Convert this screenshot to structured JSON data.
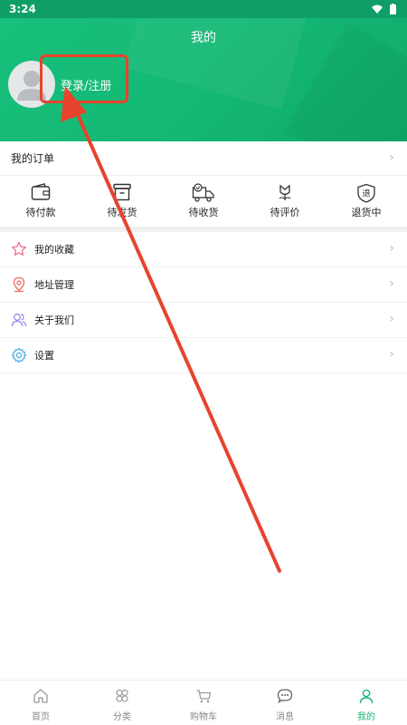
{
  "status_bar": {
    "time": "3:24"
  },
  "header": {
    "title": "我的",
    "login_label": "登录/注册"
  },
  "orders": {
    "section_title": "我的订单",
    "items": [
      {
        "label": "待付款",
        "icon": "wallet-icon"
      },
      {
        "label": "待发货",
        "icon": "box-icon"
      },
      {
        "label": "待收货",
        "icon": "truck-icon"
      },
      {
        "label": "待评价",
        "icon": "flower-icon"
      },
      {
        "label": "退货中",
        "icon": "return-shield-icon"
      }
    ]
  },
  "menu": {
    "items": [
      {
        "label": "我的收藏",
        "icon": "star-icon"
      },
      {
        "label": "地址管理",
        "icon": "location-icon"
      },
      {
        "label": "关于我们",
        "icon": "users-icon"
      },
      {
        "label": "设置",
        "icon": "gear-icon"
      }
    ]
  },
  "tabbar": {
    "items": [
      {
        "label": "首页",
        "icon": "home-icon"
      },
      {
        "label": "分类",
        "icon": "category-icon"
      },
      {
        "label": "购物车",
        "icon": "cart-icon"
      },
      {
        "label": "消息",
        "icon": "message-icon"
      },
      {
        "label": "我的",
        "icon": "person-icon",
        "active": true
      }
    ]
  },
  "colors": {
    "brand_green": "#18b673",
    "annotation_red": "#e8432d"
  }
}
